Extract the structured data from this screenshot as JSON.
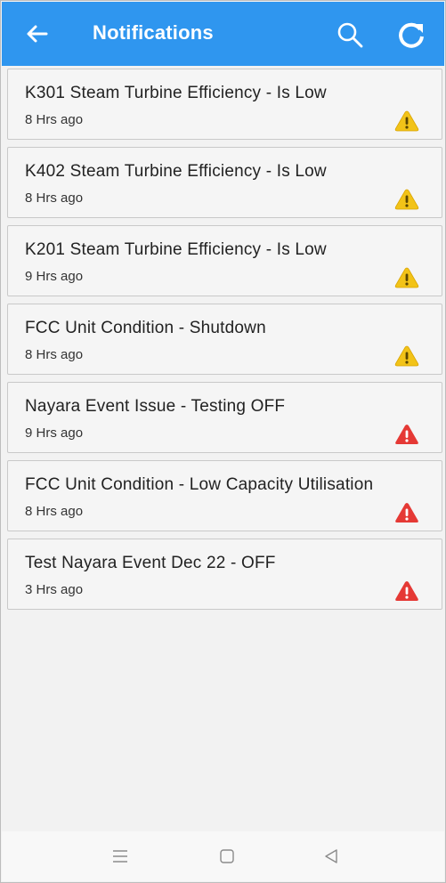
{
  "header": {
    "title": "Notifications",
    "back_icon": "arrow-left-icon",
    "search_icon": "search-icon",
    "refresh_icon": "refresh-icon",
    "bg_color": "#2f96ef"
  },
  "notifications": [
    {
      "title": "K301 Steam Turbine Efficiency - Is Low",
      "time": "8 Hrs ago",
      "severity": "warning"
    },
    {
      "title": "K402 Steam Turbine Efficiency - Is Low",
      "time": "8 Hrs ago",
      "severity": "warning"
    },
    {
      "title": "K201 Steam Turbine Efficiency - Is Low",
      "time": "9 Hrs ago",
      "severity": "warning"
    },
    {
      "title": "FCC Unit Condition - Shutdown",
      "time": "8 Hrs ago",
      "severity": "warning"
    },
    {
      "title": "Nayara Event Issue - Testing OFF",
      "time": "9 Hrs ago",
      "severity": "critical"
    },
    {
      "title": "FCC Unit Condition - Low Capacity Utilisation",
      "time": "8 Hrs ago",
      "severity": "critical"
    },
    {
      "title": "Test Nayara Event Dec 22 - OFF",
      "time": "3 Hrs ago",
      "severity": "critical"
    }
  ],
  "severity_colors": {
    "warning": "#f2c318",
    "critical": "#e53935"
  },
  "navbar": {
    "recent_icon": "menu-lines-icon",
    "home_icon": "square-home-icon",
    "back_icon": "triangle-back-icon"
  }
}
